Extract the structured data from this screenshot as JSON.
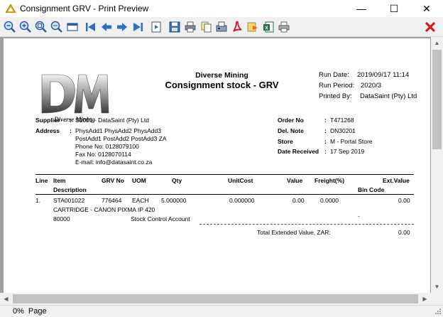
{
  "window": {
    "title": "Consignment GRV - Print Preview",
    "minimize": "—",
    "maximize": "☐",
    "close": "✕"
  },
  "toolbar": {
    "buttons": [
      "zoom-out",
      "zoom-in",
      "zoom-page",
      "zoom-width",
      "two-page",
      "first-page",
      "prev-page",
      "next-page",
      "last-page",
      "goto-page",
      "save",
      "print",
      "copy",
      "fax",
      "pdf",
      "export",
      "excel",
      "printer-setup"
    ],
    "close_icon": "red-x-icon"
  },
  "report": {
    "logo_text": "Diverse Mining",
    "company": "Diverse Mining",
    "title": "Consignment stock - GRV",
    "run_date_label": "Run Date:",
    "run_date": "2019/09/17 11:14",
    "run_period_label": "Run Period:",
    "run_period": "2020/3",
    "printed_by_label": "Printed By:",
    "printed_by": "DataSaint (Pty) Ltd",
    "supplier_label": "Supplier",
    "supplier_value": "S1001 - DataSaint (Pty) Ltd",
    "address_label": "Address",
    "colon": ":",
    "address_lines": [
      "PhysAdd1 PhysAdd2 PhysAdd3",
      "PostAdd1 PostAdd2 PostAdd3 ZA",
      "Phone No:  0128079100",
      "Fax No:    0128070114",
      "E-mail:    info@datasaint.co.za"
    ],
    "order_no_label": "Order No",
    "order_no": "T471268",
    "del_note_label": "Del. Note",
    "del_note": "DN30201",
    "store_label": "Store",
    "store": "M - Portal Store",
    "date_received_label": "Date Received",
    "date_received": "17 Sep 2019",
    "columns": {
      "line": "Line",
      "item": "Item",
      "description": "Description",
      "grv_no": "GRV No",
      "uom": "UOM",
      "qty": "Qty",
      "unit_cost": "UnitCost",
      "value": "Value",
      "freight": "Freight(%)",
      "ext_value": "Ext.Value",
      "bin_code": "Bin Code"
    },
    "row": {
      "line": "1.",
      "item": "STA001022",
      "grv_no": "776464",
      "uom": "EACH",
      "qty": "5.000000",
      "unit_cost": "0.000000",
      "value": "0.00",
      "freight": "0.0000",
      "ext_value": "0.00",
      "description": "CARTRIDGE - CANON PIXMA IP 420",
      "bin_code": "-",
      "account_code": "80000",
      "account_name": "Stock Control Account"
    },
    "total_label": "Total Extended Value, ZAR:",
    "total_value": "0.00"
  },
  "status": {
    "zoom": "0%",
    "page": "Page"
  }
}
